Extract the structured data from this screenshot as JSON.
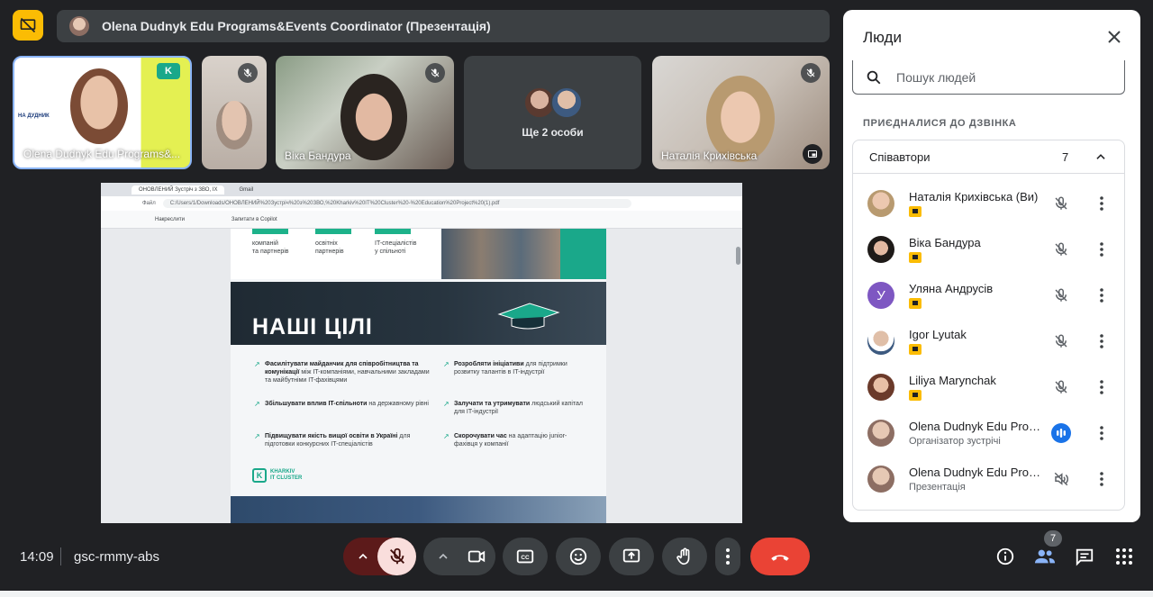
{
  "header": {
    "presenter_title": "Olena Dudnyk Edu Programs&Events Coordinator (Презентація)"
  },
  "tiles": [
    {
      "name": "Olena Dudnyk Edu Programs&...",
      "muted": false,
      "slide_name_text": "НА ДУДНИК",
      "slide_brand": "K"
    },
    {
      "name": "",
      "muted": true
    },
    {
      "name": "Віка Бандура",
      "muted": true
    },
    {
      "name": "Ще 2 особи",
      "muted": false
    },
    {
      "name": "Наталія Крихівська",
      "muted": true
    }
  ],
  "browser": {
    "tab_active": "ОНОВЛЕНИЙ Зустріч з ЗВО, IX",
    "tab_inactive": "Gmail",
    "url_host": "Файл",
    "url": "C:/Users/1/Downloads/ОНОВЛЕНИЙ%20Зустріч%20з%20ЗВО,%20Kharkiv%20IT%20Cluster%20-%20Education%20Project%20(1).pdf",
    "toolbar_draw": "Накреслити",
    "toolbar_copilot": "Запитати в Copilot"
  },
  "slide": {
    "stats": [
      {
        "label": "компаній\nта партнерів"
      },
      {
        "label": "освітніх\nпартнерів"
      },
      {
        "label": "IT-спеціалістів\nу спільноті"
      }
    ],
    "goals_title": "НАШІ ЦІЛІ",
    "goals": [
      {
        "bold": "Фасилітувати майданчик для співробітництва та комунікації",
        "rest": " між IT-компаніями, навчальними закладами та майбутніми IT-фахівцями"
      },
      {
        "bold": "Розробляти ініціативи",
        "rest": " для підтримки розвитку талантів в IT-індустрії"
      },
      {
        "bold": "Збільшувати вплив IT-спільноти",
        "rest": " на державному рівні"
      },
      {
        "bold": "Залучати та утримувати",
        "rest": " людський капітал для IT-індустрії"
      },
      {
        "bold": "Підвищувати якість вищої освіти в Україні",
        "rest": " для підготовки конкурсних IT-спеціалістів"
      },
      {
        "bold": "Скорочувати час",
        "rest": " на адаптацію junior-фахівця у компанії"
      }
    ],
    "logo_line1": "KHARKIV",
    "logo_line2": "IT CLUSTER"
  },
  "footer": {
    "time": "14:09",
    "meeting_code": "gsc-rmmy-abs",
    "people_badge": "7"
  },
  "panel": {
    "title": "Люди",
    "search_placeholder": "Пошук людей",
    "section_label": "ПРИЄДНАЛИСЯ ДО ДЗВІНКА",
    "group_title": "Співавтори",
    "group_count": "7",
    "people": [
      {
        "name": "Наталія Крихівська (Ви)",
        "sub": "",
        "mic": "off"
      },
      {
        "name": "Віка Бандура",
        "sub": "",
        "mic": "off"
      },
      {
        "name": "Уляна Андрусів",
        "sub": "",
        "mic": "off",
        "initial": "У"
      },
      {
        "name": "Igor Lyutak",
        "sub": "",
        "mic": "off"
      },
      {
        "name": "Liliya Marynchak",
        "sub": "",
        "mic": "off"
      },
      {
        "name": "Olena Dudnyk Edu Prog...",
        "sub": "Організатор зустрічі",
        "mic": "speaking"
      },
      {
        "name": "Olena Dudnyk Edu Prog...",
        "sub": "Презентація",
        "mic": "audio-off"
      }
    ]
  },
  "colors": {
    "background": "#202124",
    "accent_yellow": "#fbbc04",
    "end_call_red": "#ea4335",
    "mic_off_bg": "#f9dedc",
    "slide_green": "#1aa88a"
  }
}
